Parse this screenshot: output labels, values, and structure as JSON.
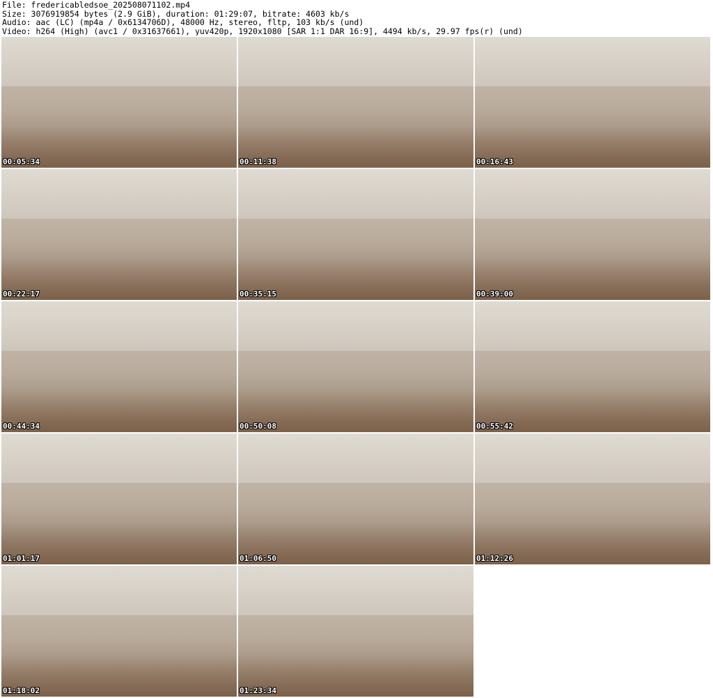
{
  "header": {
    "file_line": "File: fredericabledsoe_202508071102.mp4",
    "size_line": "Size: 3076919854 bytes (2.9 GiB), duration: 01:29:07, bitrate: 4603 kb/s",
    "audio_line": "Audio: aac (LC) (mp4a / 0x6134706D), 48000 Hz, stereo, fltp, 103 kb/s (und)",
    "video_line": "Video: h264 (High) (avc1 / 0x31637661), yuv420p, 1920x1080 [SAR 1:1 DAR 16:9], 4494 kb/s, 29.97 fps(r) (und)"
  },
  "thumbnails": [
    {
      "timestamp": "00:05:34"
    },
    {
      "timestamp": "00:11:38"
    },
    {
      "timestamp": "00:16:43"
    },
    {
      "timestamp": "00:22:17"
    },
    {
      "timestamp": "00:35:15"
    },
    {
      "timestamp": "00:39:00"
    },
    {
      "timestamp": "00:44:34"
    },
    {
      "timestamp": "00:50:08"
    },
    {
      "timestamp": "00:55:42"
    },
    {
      "timestamp": "01:01:17"
    },
    {
      "timestamp": "01:06:50"
    },
    {
      "timestamp": "01:12:26"
    },
    {
      "timestamp": "01:18:02"
    },
    {
      "timestamp": "01:23:34"
    }
  ]
}
